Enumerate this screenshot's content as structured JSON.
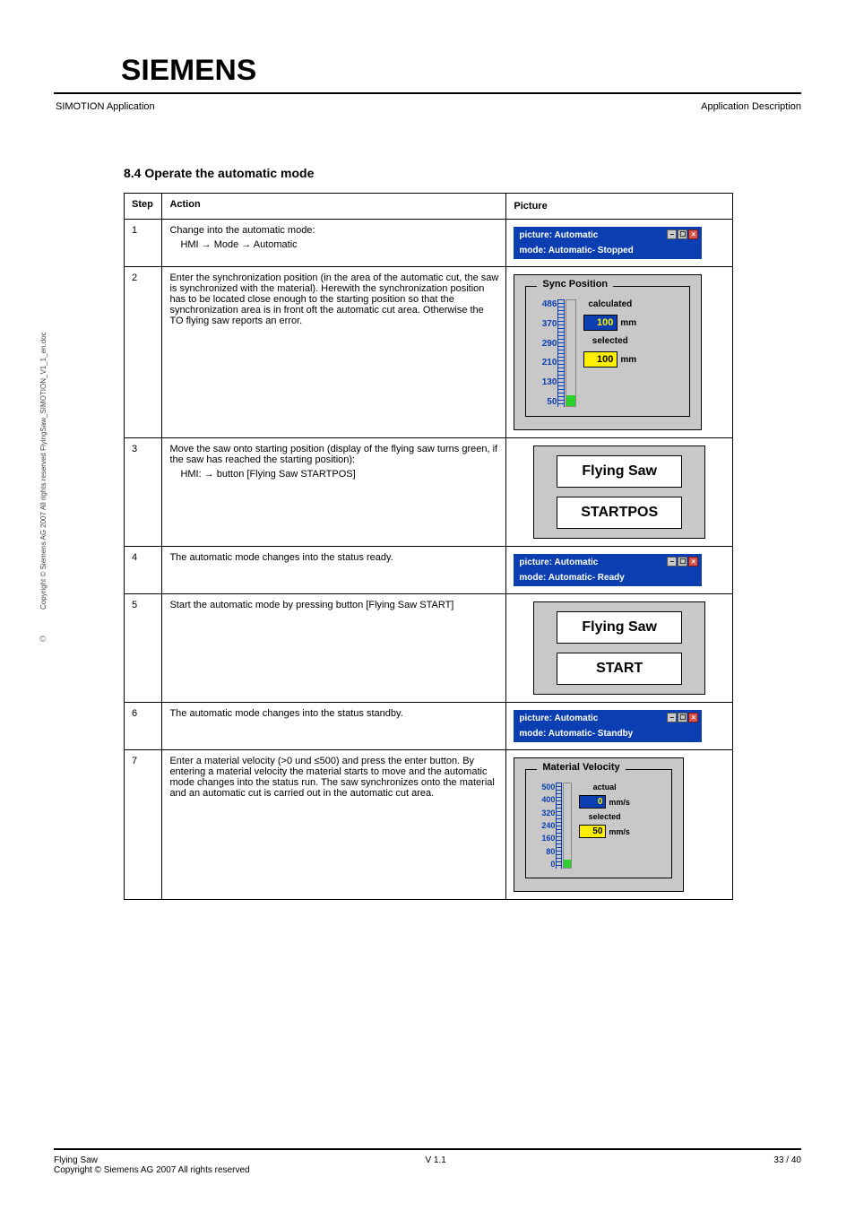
{
  "logo": "SIEMENS",
  "header": {
    "left": "SIMOTION Application",
    "right": "Application Description"
  },
  "section_title": "8.4 Operate the automatic mode",
  "table": {
    "headers": {
      "step": "Step",
      "action": "Action",
      "picture": "Picture"
    },
    "rows": [
      {
        "step": "1",
        "action": "Change into the automatic mode:",
        "subaction": "HMI → Mode → Automatic",
        "picture_lines": [
          "picture: Automatic",
          "mode: Automatic- Stopped"
        ]
      },
      {
        "step": "2",
        "action": "Enter the synchronization position (in the area of the automatic cut, the saw is synchronized with the material). Herewith the synchronization position has to be located close enough to the starting position so that the synchronization area is in front oft the automatic cut area. Otherwise the TO flying saw reports an error.",
        "subaction": "",
        "gauge": {
          "legend": "Sync Position",
          "ticks": [
            "486",
            "370",
            "290",
            "210",
            "130",
            "50"
          ],
          "bar_pct": 10,
          "readouts": [
            {
              "label": "calculated",
              "value": "100",
              "unit": "mm",
              "style": "blue"
            },
            {
              "label": "selected",
              "value": "100",
              "unit": "mm",
              "style": "yellow"
            }
          ]
        }
      },
      {
        "step": "3",
        "action": "Move the saw onto starting position (display of the flying saw turns green, if the saw has reached the starting position):",
        "subaction": "HMI: → button [Flying Saw STARTPOS]",
        "button_panel": {
          "title": "Flying Saw",
          "label": "STARTPOS"
        }
      },
      {
        "step": "4",
        "action": "The automatic mode changes into the status ready.",
        "subaction": "",
        "picture_lines": [
          "picture: Automatic",
          "mode: Automatic- Ready"
        ]
      },
      {
        "step": "5",
        "action": "Start the automatic mode by pressing button [Flying Saw START]",
        "subaction": "",
        "button_panel": {
          "title": "Flying Saw",
          "label": "START"
        }
      },
      {
        "step": "6",
        "action": "The automatic mode changes into the status standby.",
        "subaction": "",
        "picture_lines": [
          "picture: Automatic",
          "mode: Automatic- Standby"
        ]
      },
      {
        "step": "7",
        "action": "Enter a material velocity (>0 und ≤500) and press the enter button. By entering a material velocity the material starts to move and the automatic mode changes into the status run. The saw synchronizes onto the material and an automatic cut is carried out in the automatic cut area.",
        "subaction": "",
        "gauge": {
          "legend": "Material Velocity",
          "ticks": [
            "500",
            "400",
            "320",
            "240",
            "160",
            "80",
            "0"
          ],
          "bar_pct": 10,
          "readouts": [
            {
              "label": "actual",
              "value": "0",
              "unit": "mm/s",
              "style": "blue"
            },
            {
              "label": "selected",
              "value": "50",
              "unit": "mm/s",
              "style": "yellow"
            }
          ]
        }
      }
    ]
  },
  "footer": {
    "left": "Flying Saw",
    "center": "V 1.1",
    "right": "33 / 40",
    "line2": "Copyright © Siemens AG 2007 All rights reserved"
  },
  "side_copyright": "Copyright © Siemens AG 2007 All rights reserved     FlyingSaw_SIMOTION_V1_1_en.doc"
}
